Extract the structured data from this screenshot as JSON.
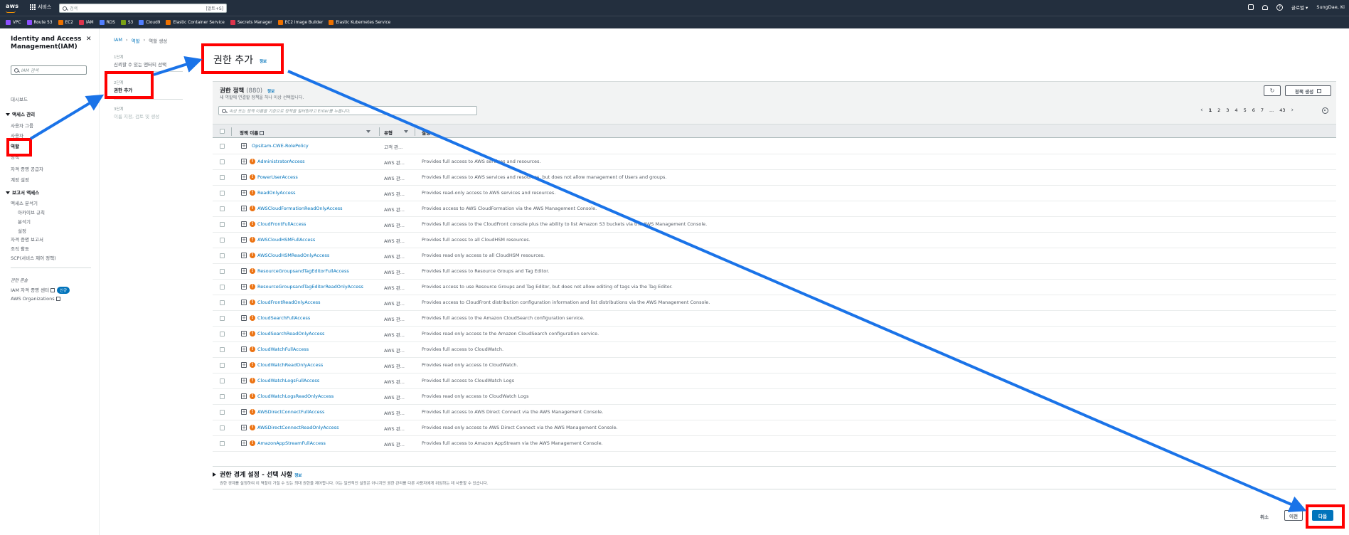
{
  "nav": {
    "logo": "aws",
    "services_label": "서비스",
    "search_placeholder": "검색",
    "search_shortcut": "[알트+S]",
    "region": "글로벌 ▾",
    "user": "SungDae, Ki"
  },
  "favorites": [
    {
      "label": "VPC",
      "color": "#8c4fff"
    },
    {
      "label": "Route 53",
      "color": "#8c4fff"
    },
    {
      "label": "EC2",
      "color": "#ed7100"
    },
    {
      "label": "IAM",
      "color": "#dd344c"
    },
    {
      "label": "RDS",
      "color": "#527fff"
    },
    {
      "label": "S3",
      "color": "#7aa116"
    },
    {
      "label": "Cloud9",
      "color": "#527fff"
    },
    {
      "label": "Elastic Container Service",
      "color": "#ed7100"
    },
    {
      "label": "Secrets Manager",
      "color": "#dd344c"
    },
    {
      "label": "EC2 Image Builder",
      "color": "#ed7100"
    },
    {
      "label": "Elastic Kubernetes Service",
      "color": "#ed7100"
    }
  ],
  "sidebar": {
    "title": "Identity and Access Management(IAM)",
    "close": "✕",
    "search_placeholder": "IAM 검색",
    "dashboard": "대시보드",
    "access_mgmt": "액세스 관리",
    "user_groups": "사용자 그룹",
    "users": "사용자",
    "roles": "역할",
    "policies": "정책",
    "id_providers": "자격 증명 공급자",
    "account_settings": "계정 설정",
    "access_reports": "보고서 액세스",
    "access_analyzer": "액세스 분석기",
    "archive_rules": "아카이브 규칙",
    "analyzer": "분석기",
    "settings": "설정",
    "cred_report": "자격 증명 보고서",
    "org_activity": "조직 활동",
    "scp": "SCP(서비스 제어 정책)",
    "related": "관련 콘솔",
    "identity_center": "IAM 자격 증명 센터",
    "new_badge": "신규",
    "organizations": "AWS Organizations"
  },
  "breadcrumb": {
    "iam": "IAM",
    "roles": "역할",
    "create": "역할 생성"
  },
  "steps": [
    {
      "num": "1단계",
      "label": "신뢰할 수 있는 엔터티 선택"
    },
    {
      "num": "2단계",
      "label": "권한 추가"
    },
    {
      "num": "3단계",
      "label": "이름 지정, 검토 및 생성"
    }
  ],
  "page": {
    "title": "권한 추가",
    "info": "정보"
  },
  "policies": {
    "title": "권한 정책",
    "count": "(880)",
    "info": "정보",
    "description": "새 역할에 연결할 정책을 하나 이상 선택합니다.",
    "refresh_icon": "↻",
    "create_label": "정책 생성",
    "search_placeholder": "속성 또는 정책 이름을 기준으로 정책을 필터링하고 Enter를 누릅니다.",
    "pages": [
      "1",
      "2",
      "3",
      "4",
      "5",
      "6",
      "7",
      "...",
      "43"
    ],
    "col_name": "정책 이름",
    "col_type": "유형",
    "col_desc": "설명",
    "rows": [
      {
        "name": "Opsitam-CWE-RolePolicy",
        "type": "고객 관...",
        "desc": "",
        "aws": false
      },
      {
        "name": "AdministratorAccess",
        "type": "AWS 관...",
        "desc": "Provides full access to AWS services and resources.",
        "aws": true
      },
      {
        "name": "PowerUserAccess",
        "type": "AWS 관...",
        "desc": "Provides full access to AWS services and resources, but does not allow management of Users and groups.",
        "aws": true
      },
      {
        "name": "ReadOnlyAccess",
        "type": "AWS 관...",
        "desc": "Provides read-only access to AWS services and resources.",
        "aws": true
      },
      {
        "name": "AWSCloudFormationReadOnlyAccess",
        "type": "AWS 관...",
        "desc": "Provides access to AWS CloudFormation via the AWS Management Console.",
        "aws": true
      },
      {
        "name": "CloudFrontFullAccess",
        "type": "AWS 관...",
        "desc": "Provides full access to the CloudFront console plus the ability to list Amazon S3 buckets via the AWS Management Console.",
        "aws": true
      },
      {
        "name": "AWSCloudHSMFullAccess",
        "type": "AWS 관...",
        "desc": "Provides full access to all CloudHSM resources.",
        "aws": true
      },
      {
        "name": "AWSCloudHSMReadOnlyAccess",
        "type": "AWS 관...",
        "desc": "Provides read only access to all CloudHSM resources.",
        "aws": true
      },
      {
        "name": "ResourceGroupsandTagEditorFullAccess",
        "type": "AWS 관...",
        "desc": "Provides full access to Resource Groups and Tag Editor.",
        "aws": true
      },
      {
        "name": "ResourceGroupsandTagEditorReadOnlyAccess",
        "type": "AWS 관...",
        "desc": "Provides access to use Resource Groups and Tag Editor, but does not allow editing of tags via the Tag Editor.",
        "aws": true
      },
      {
        "name": "CloudFrontReadOnlyAccess",
        "type": "AWS 관...",
        "desc": "Provides access to CloudFront distribution configuration information and list distributions via the AWS Management Console.",
        "aws": true
      },
      {
        "name": "CloudSearchFullAccess",
        "type": "AWS 관...",
        "desc": "Provides full access to the Amazon CloudSearch configuration service.",
        "aws": true
      },
      {
        "name": "CloudSearchReadOnlyAccess",
        "type": "AWS 관...",
        "desc": "Provides read only access to the Amazon CloudSearch configuration service.",
        "aws": true
      },
      {
        "name": "CloudWatchFullAccess",
        "type": "AWS 관...",
        "desc": "Provides full access to CloudWatch.",
        "aws": true
      },
      {
        "name": "CloudWatchReadOnlyAccess",
        "type": "AWS 관...",
        "desc": "Provides read only access to CloudWatch.",
        "aws": true
      },
      {
        "name": "CloudWatchLogsFullAccess",
        "type": "AWS 관...",
        "desc": "Provides full access to CloudWatch Logs",
        "aws": true
      },
      {
        "name": "CloudWatchLogsReadOnlyAccess",
        "type": "AWS 관...",
        "desc": "Provides read only access to CloudWatch Logs",
        "aws": true
      },
      {
        "name": "AWSDirectConnectFullAccess",
        "type": "AWS 관...",
        "desc": "Provides full access to AWS Direct Connect via the AWS Management Console.",
        "aws": true
      },
      {
        "name": "AWSDirectConnectReadOnlyAccess",
        "type": "AWS 관...",
        "desc": "Provides read only access to AWS Direct Connect via the AWS Management Console.",
        "aws": true
      },
      {
        "name": "AmazonAppStreamFullAccess",
        "type": "AWS 관...",
        "desc": "Provides full access to Amazon AppStream via the AWS Management Console.",
        "aws": true
      }
    ]
  },
  "boundary": {
    "title": "권한 경계 설정 - 선택 사항",
    "info": "정보",
    "description": "권한 경계를 설정하여 이 역할이 가질 수 있는 최대 권한을 제어합니다. 이는 일반적인 설정은 아니지만 권한 관리를 다른 사용자에게 위임하는 데 사용할 수 있습니다."
  },
  "footer": {
    "cancel": "취소",
    "prev": "이전",
    "next": "다음"
  },
  "annotation_color": "#ff0000",
  "arrow_color": "#1a73e8"
}
